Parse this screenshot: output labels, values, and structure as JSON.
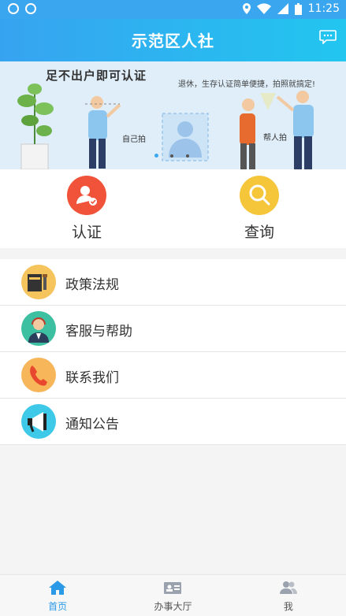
{
  "status": {
    "time": "11:25"
  },
  "app": {
    "title": "示范区人社"
  },
  "banner": {
    "headline": "足不出户即可认证",
    "tagline": "退休，生存认证简单便捷，拍照就搞定!",
    "label_self": "自己拍",
    "label_help": "帮人拍"
  },
  "quick": {
    "certify": "认证",
    "query": "查询"
  },
  "menu": [
    {
      "label": "政策法规"
    },
    {
      "label": "客服与帮助"
    },
    {
      "label": "联系我们"
    },
    {
      "label": "通知公告"
    }
  ],
  "tabs": {
    "home": "首页",
    "service": "办事大厅",
    "me": "我"
  },
  "colors": {
    "accent": "#2a9ae8",
    "certify": "#f0533a",
    "query": "#f5c53a"
  }
}
